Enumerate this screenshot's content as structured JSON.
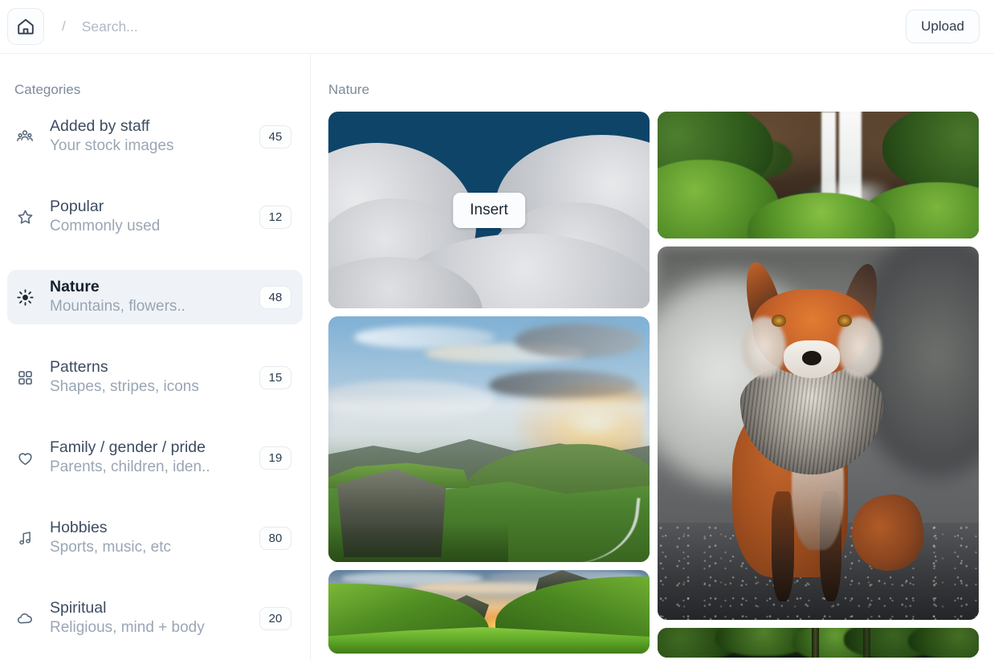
{
  "header": {
    "home_icon": "home-icon",
    "separator": "/",
    "search_placeholder": "Search...",
    "search_value": "",
    "upload_label": "Upload"
  },
  "sidebar": {
    "title": "Categories",
    "items": [
      {
        "icon": "users-group-icon",
        "label": "Added by staff",
        "desc": "Your stock images",
        "count": "45",
        "selected": false
      },
      {
        "icon": "star-icon",
        "label": "Popular",
        "desc": "Commonly used",
        "count": "12",
        "selected": false
      },
      {
        "icon": "sun-icon",
        "label": "Nature",
        "desc": "Mountains, flowers..",
        "count": "48",
        "selected": true
      },
      {
        "icon": "grid-icon",
        "label": "Patterns",
        "desc": "Shapes, stripes, icons",
        "count": "15",
        "selected": false
      },
      {
        "icon": "heart-icon",
        "label": "Family / gender / pride",
        "desc": "Parents, children, iden..",
        "count": "19",
        "selected": false
      },
      {
        "icon": "music-note-icon",
        "label": "Hobbies",
        "desc": "Sports, music, etc",
        "count": "80",
        "selected": false
      },
      {
        "icon": "cloud-icon",
        "label": "Spiritual",
        "desc": "Religious, mind + body",
        "count": "20",
        "selected": false
      }
    ]
  },
  "main": {
    "title": "Nature",
    "insert_label": "Insert",
    "tiles": [
      {
        "id": "night-clouds-moon",
        "alt": "Crescent moon between grey clouds in dark blue night sky",
        "hovered": true
      },
      {
        "id": "mountain-sunset",
        "alt": "Green mountain valley with cliffs at sunset",
        "hovered": false
      },
      {
        "id": "green-valley-sunset",
        "alt": "Bright green valley with glowing sunset",
        "hovered": false
      },
      {
        "id": "waterfall-forest",
        "alt": "Waterfall surrounded by lush green foliage",
        "hovered": false
      },
      {
        "id": "red-fox",
        "alt": "Red fox sitting on gravel with desaturated background",
        "hovered": false
      },
      {
        "id": "dark-forest-canopy",
        "alt": "Dark green forest canopy",
        "hovered": false
      }
    ]
  },
  "colors": {
    "page_background": "#ffffff",
    "border": "#edf0f4",
    "selected_item_background": "#eff3f8",
    "text_primary": "#16202c",
    "text_secondary": "#3d4c60",
    "text_muted": "#9aa6b5",
    "title_muted": "#7e8b9b",
    "night_sky": "#0e4468"
  }
}
